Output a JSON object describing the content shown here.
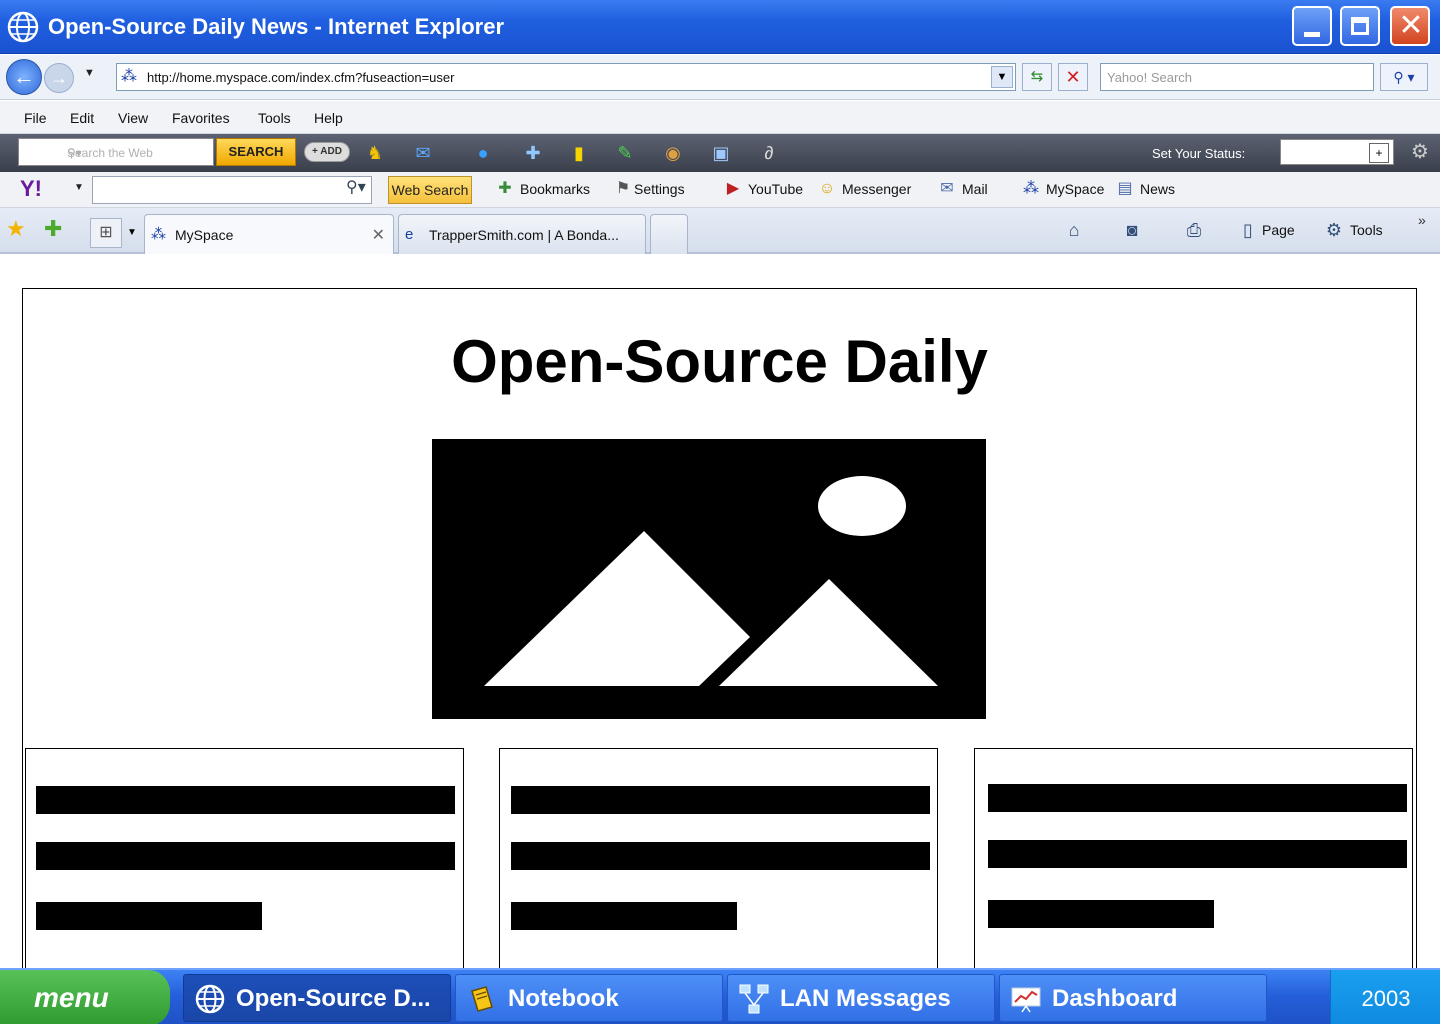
{
  "window": {
    "title": "Open-Source Daily News - Internet Explorer"
  },
  "address_bar": {
    "url": "http://home.myspace.com/index.cfm?fuseaction=user",
    "search_placeholder": "Yahoo! Search"
  },
  "menu": [
    "File",
    "Edit",
    "View",
    "Favorites",
    "Tools",
    "Help"
  ],
  "google_bar": {
    "search_placeholder": "Search the Web",
    "search_button": "SEARCH",
    "add_button": "+ ADD",
    "status_label": "Set Your Status:"
  },
  "yahoo_bar": {
    "logo": "Y!",
    "web_search": "Web Search",
    "bookmarks": "Bookmarks",
    "settings": "Settings",
    "youtube": "YouTube",
    "messenger": "Messenger",
    "mail": "Mail",
    "myspace": "MySpace",
    "news": "News"
  },
  "tabs": [
    {
      "label": "MySpace"
    },
    {
      "label": "TrapperSmith.com | A Bonda..."
    }
  ],
  "command_bar": {
    "page": "Page",
    "tools": "Tools"
  },
  "page": {
    "title": "Open-Source Daily",
    "image_alt_icon": "image-placeholder-icon"
  },
  "taskbar": {
    "start": "menu",
    "tasks": [
      {
        "label": "Open-Source D...",
        "icon": "globe-icon",
        "active": true
      },
      {
        "label": "Notebook",
        "icon": "notebook-icon",
        "active": false
      },
      {
        "label": "LAN Messages",
        "icon": "network-icon",
        "active": false
      },
      {
        "label": "Dashboard",
        "icon": "chart-icon",
        "active": false
      }
    ],
    "clock": "2003"
  },
  "colors": {
    "titlebar": "#1f5fe0",
    "taskbar": "#245ed8",
    "start_button": "#3aa63a",
    "tray": "#0f8ae0"
  }
}
